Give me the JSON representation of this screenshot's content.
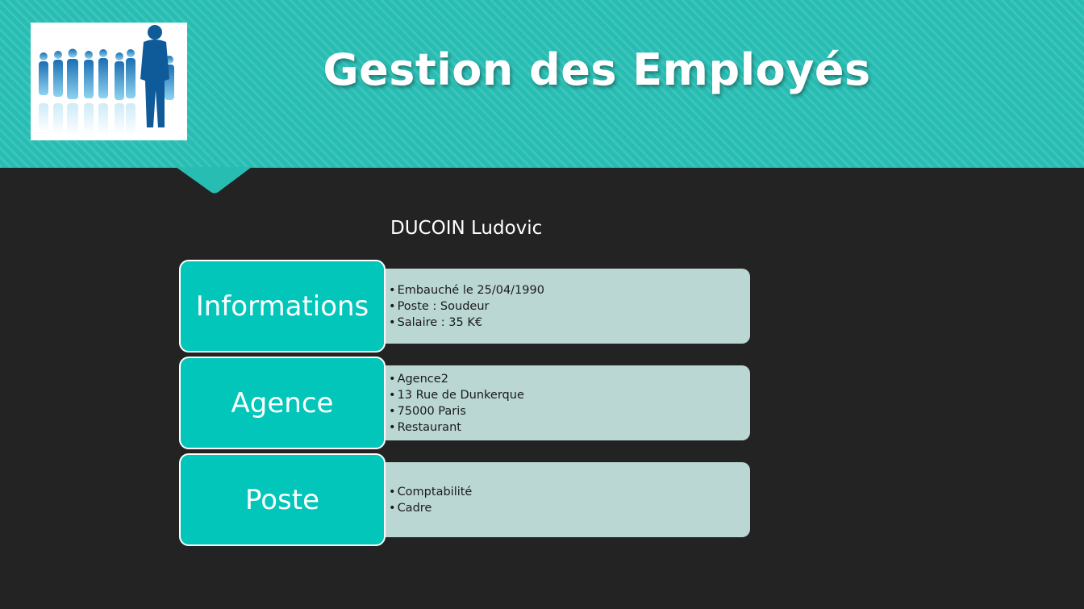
{
  "slide": {
    "title": "Gestion des Employés",
    "logo_icon": "employees-silhouette-logo",
    "employee_name": "DUCOIN Ludovic"
  },
  "sections": [
    {
      "label": "Informations",
      "items": [
        "Embauché le 25/04/1990",
        "Poste : Soudeur",
        "Salaire : 35 K€"
      ]
    },
    {
      "label": "Agence",
      "items": [
        "Agence2",
        "13 Rue de Dunkerque",
        "75000 Paris",
        "Restaurant"
      ]
    },
    {
      "label": "Poste",
      "items": [
        "Comptabilité",
        "Cadre"
      ]
    }
  ],
  "colors": {
    "header_teal": "#27bdb3",
    "label_teal": "#02c6b9",
    "panel_bg": "#bad7d3",
    "slide_bg": "#232323"
  }
}
